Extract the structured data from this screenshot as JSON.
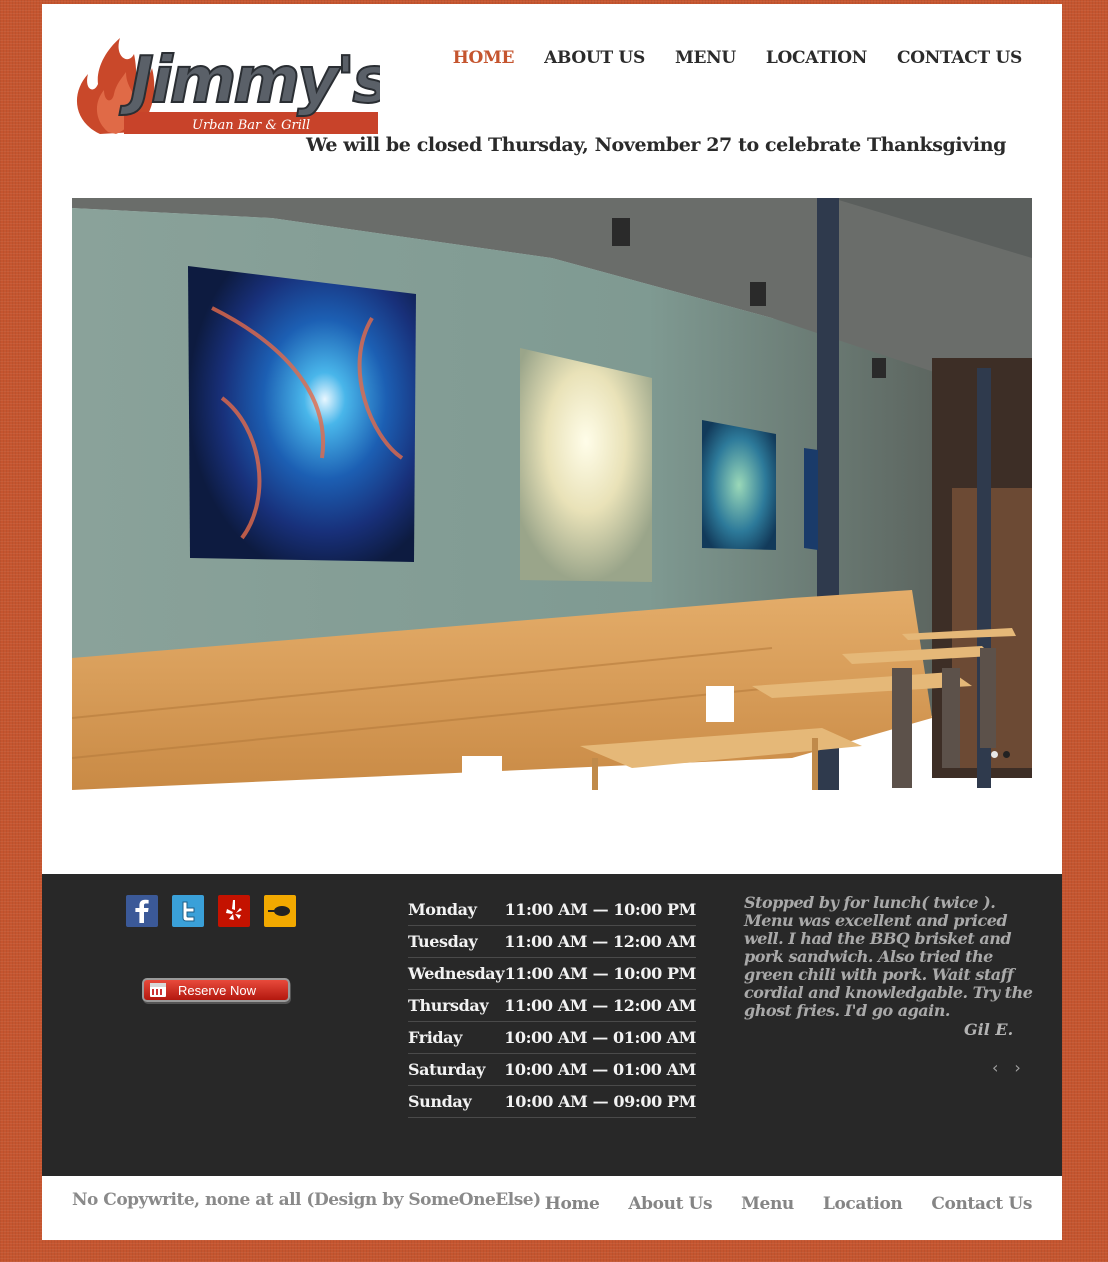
{
  "brand": {
    "name": "Jimmy's",
    "tagline": "Urban Bar & Grill"
  },
  "nav": {
    "items": [
      {
        "label": "HOME",
        "active": true
      },
      {
        "label": "ABOUT US",
        "active": false
      },
      {
        "label": "MENU",
        "active": false
      },
      {
        "label": "LOCATION",
        "active": false
      },
      {
        "label": "CONTACT US",
        "active": false
      }
    ]
  },
  "notice": "We will be closed Thursday, November 27 to celebrate Thanksgiving",
  "slider": {
    "slide_count": 2,
    "active_slide": 2
  },
  "social": [
    {
      "icon": "facebook-icon",
      "color": "#3b5998"
    },
    {
      "icon": "twitter-icon",
      "color": "#3aa0d8"
    },
    {
      "icon": "yelp-icon",
      "color": "#c41200"
    },
    {
      "icon": "urbanspoon-icon",
      "color": "#f2a900"
    }
  ],
  "reserve": {
    "label": "Reserve Now"
  },
  "hours": [
    {
      "day": "Monday",
      "time": "11:00 AM — 10:00 PM"
    },
    {
      "day": "Tuesday",
      "time": "11:00 AM — 12:00 AM"
    },
    {
      "day": "Wednesday",
      "time": "11:00 AM — 10:00 PM"
    },
    {
      "day": "Thursday",
      "time": "11:00 AM — 12:00 AM"
    },
    {
      "day": "Friday",
      "time": "10:00 AM — 01:00 AM"
    },
    {
      "day": "Saturday",
      "time": "10:00 AM — 01:00 AM"
    },
    {
      "day": "Sunday",
      "time": "10:00 AM — 09:00 PM"
    }
  ],
  "testimonial": {
    "text": "Stopped by for lunch( twice ). Menu was excellent and priced well. I had the BBQ brisket and pork sandwich. Also tried the green chili with pork. Wait staff cordial and knowledgable. Try the ghost fries. I'd go again.",
    "author": "Gil E.",
    "prev": "‹",
    "next": "›"
  },
  "footer": {
    "copyright": "No Copywrite, none at all (Design by SomeOneElse)",
    "nav": [
      "Home",
      "About Us",
      "Menu",
      "Location",
      "Contact Us"
    ]
  },
  "colors": {
    "accent": "#c5552f",
    "footer_bg": "#282828"
  }
}
